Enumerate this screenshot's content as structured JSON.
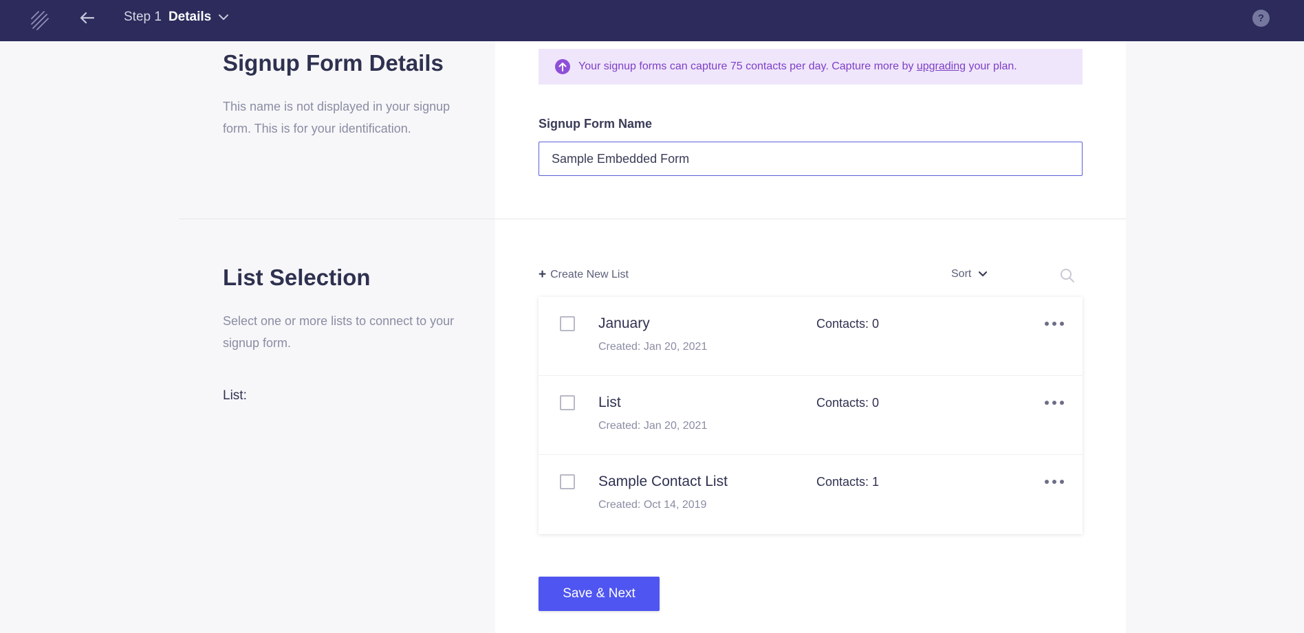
{
  "topbar": {
    "step_label": "Step 1",
    "step_title": "Details",
    "help_label": "?",
    "icons": {
      "logo": "logo-icon",
      "back": "arrow-left-icon",
      "step_dropdown": "chevron-down-icon",
      "help": "help-icon"
    },
    "colors": {
      "background": "#2c2b5c"
    }
  },
  "details_section": {
    "title": "Signup Form Details",
    "description": "This name is not displayed in your signup form. This is for your identification."
  },
  "notice": {
    "text_before": "Your signup forms can capture 75 contacts per day. Capture more by ",
    "link_text": "upgrading",
    "text_after": " your plan.",
    "icon": "arrow-up-circle-icon",
    "colors": {
      "background": "#efe6fb",
      "text": "#7e3fc7"
    }
  },
  "form_name": {
    "label": "Signup Form Name",
    "value": "Sample Embedded Form"
  },
  "list_section": {
    "title": "List Selection",
    "description": "Select one or more lists to connect to your signup form.",
    "list_label": "List:",
    "create_new_label": "Create New List",
    "sort_label": "Sort",
    "lists": [
      {
        "name": "January",
        "created": "Created: Jan 20, 2021",
        "contacts": "Contacts: 0",
        "checked": false
      },
      {
        "name": "List",
        "created": "Created: Jan 20, 2021",
        "contacts": "Contacts: 0",
        "checked": false
      },
      {
        "name": "Sample Contact List",
        "created": "Created: Oct 14, 2019",
        "contacts": "Contacts: 1",
        "checked": false
      }
    ]
  },
  "actions": {
    "save_next_label": "Save & Next",
    "colors": {
      "primary": "#4f55f0"
    }
  }
}
